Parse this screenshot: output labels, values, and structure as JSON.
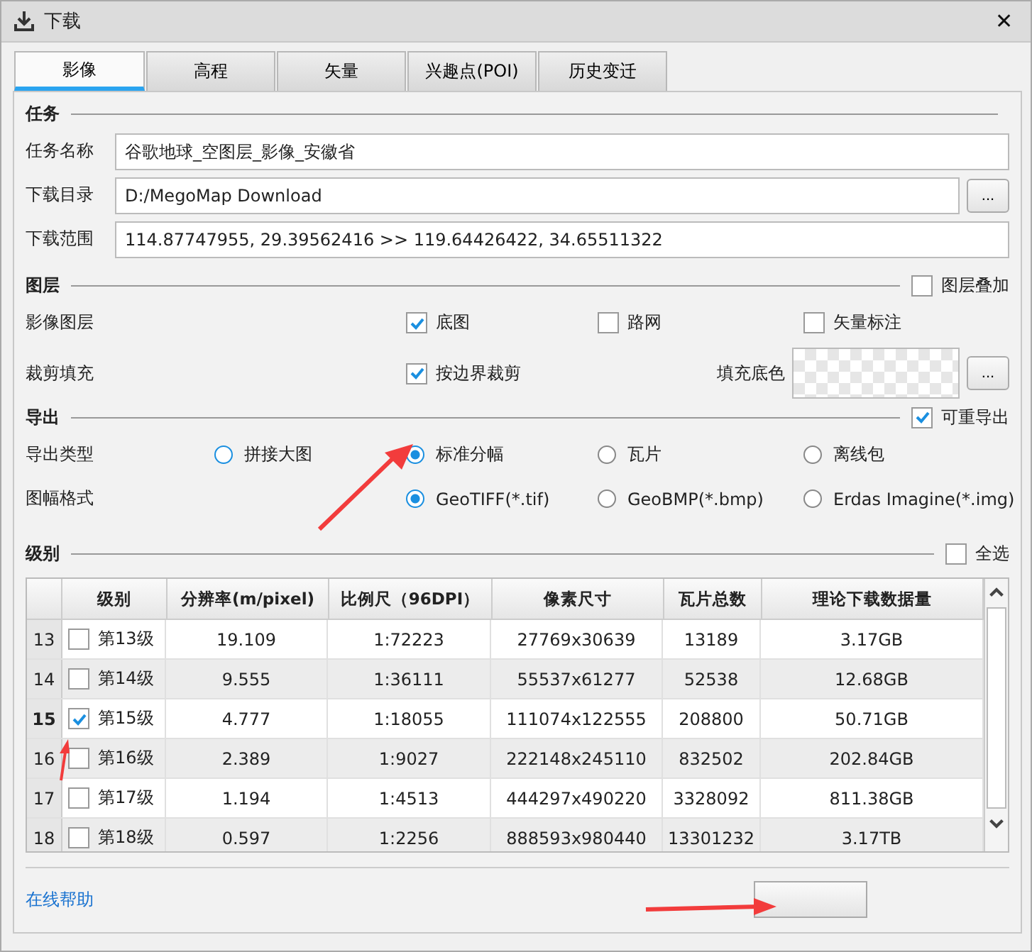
{
  "window": {
    "title": "下载",
    "close": "✕"
  },
  "tabs": [
    {
      "label": "影像",
      "selected": true
    },
    {
      "label": "高程",
      "selected": false
    },
    {
      "label": "矢量",
      "selected": false
    },
    {
      "label": "兴趣点(POI)",
      "selected": false
    },
    {
      "label": "历史变迁",
      "selected": false
    }
  ],
  "task": {
    "heading": "任务",
    "fields": [
      {
        "label": "任务名称",
        "value": "谷歌地球_空图层_影像_安徽省"
      },
      {
        "label": "下载目录",
        "value": "D:/MegoMap Download",
        "browse": "..."
      },
      {
        "label": "下载范围",
        "value": "114.87747955, 29.39562416 >> 119.64426422, 34.65511322"
      }
    ]
  },
  "layers": {
    "heading": "图层",
    "overlay": {
      "label": "图层叠加",
      "checked": false
    },
    "image_layers": {
      "label": "影像图层",
      "options": [
        {
          "label": "底图",
          "checked": true
        },
        {
          "label": "路网",
          "checked": false
        },
        {
          "label": "矢量标注",
          "checked": false
        }
      ]
    },
    "clip_fill": {
      "label": "裁剪填充",
      "option": {
        "label": "按边界裁剪",
        "checked": true
      },
      "fill_label": "填充底色",
      "browse": "..."
    }
  },
  "export": {
    "heading": "导出",
    "repeatable": {
      "label": "可重导出",
      "checked": true
    },
    "type": {
      "label": "导出类型",
      "options": [
        {
          "label": "拼接大图",
          "selected": false
        },
        {
          "label": "标准分幅",
          "selected": true
        },
        {
          "label": "瓦片",
          "selected": false
        },
        {
          "label": "离线包",
          "selected": false
        }
      ]
    },
    "format": {
      "label": "图幅格式",
      "options": [
        {
          "label": "GeoTIFF(*.tif)",
          "selected": true
        },
        {
          "label": "GeoBMP(*.bmp)",
          "selected": false
        },
        {
          "label": "Erdas Imagine(*.img)",
          "selected": false
        }
      ]
    }
  },
  "levels": {
    "heading": "级别",
    "select_all": {
      "label": "全选",
      "checked": false
    },
    "columns": [
      "级别",
      "分辨率(m/pixel)",
      "比例尺（96DPI）",
      "像素尺寸",
      "瓦片总数",
      "理论下载数据量"
    ],
    "rows": [
      {
        "index": "13",
        "selected": false,
        "checked": false,
        "cells": [
          "第13级",
          "19.109",
          "1:72223",
          "27769x30639",
          "13189",
          "3.17GB"
        ]
      },
      {
        "index": "14",
        "selected": false,
        "checked": false,
        "cells": [
          "第14级",
          "9.555",
          "1:36111",
          "55537x61277",
          "52538",
          "12.68GB"
        ]
      },
      {
        "index": "15",
        "selected": true,
        "checked": true,
        "cells": [
          "第15级",
          "4.777",
          "1:18055",
          "111074x122555",
          "208800",
          "50.71GB"
        ]
      },
      {
        "index": "16",
        "selected": false,
        "checked": false,
        "cells": [
          "第16级",
          "2.389",
          "1:9027",
          "222148x245110",
          "832502",
          "202.84GB"
        ]
      },
      {
        "index": "17",
        "selected": false,
        "checked": false,
        "cells": [
          "第17级",
          "1.194",
          "1:4513",
          "444297x490220",
          "3328092",
          "811.38GB"
        ]
      },
      {
        "index": "18",
        "selected": false,
        "checked": false,
        "cells": [
          "第18级",
          "0.597",
          "1:2256",
          "888593x980440",
          "13301232",
          "3.17TB"
        ]
      }
    ]
  },
  "footer": {
    "help_link": "在线帮助"
  }
}
